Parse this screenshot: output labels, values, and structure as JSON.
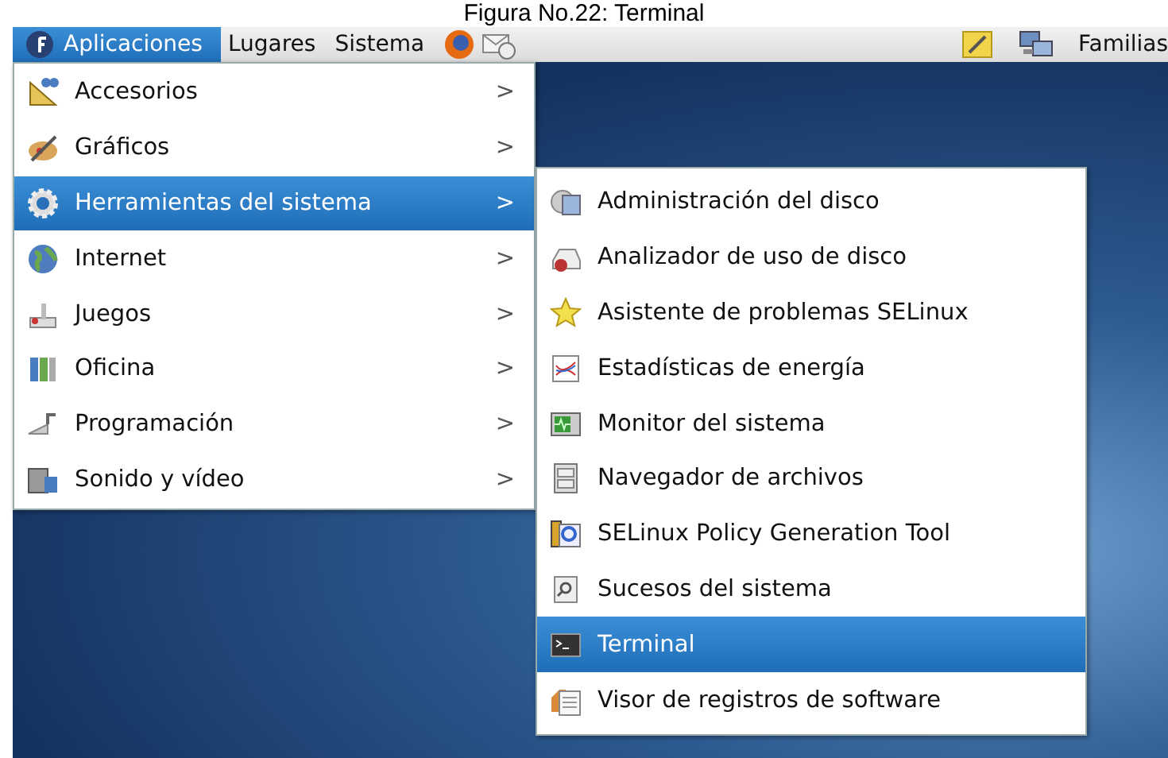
{
  "caption": "Figura No.22: Terminal",
  "panel": {
    "menus": [
      {
        "label": "Aplicaciones",
        "selected": true
      },
      {
        "label": "Lugares",
        "selected": false
      },
      {
        "label": "Sistema",
        "selected": false
      }
    ],
    "user": "Familias"
  },
  "menu": {
    "items": [
      {
        "label": "Accesorios",
        "arrow": ">",
        "selected": false
      },
      {
        "label": "Gráficos",
        "arrow": ">",
        "selected": false
      },
      {
        "label": "Herramientas del sistema",
        "arrow": ">",
        "selected": true
      },
      {
        "label": "Internet",
        "arrow": ">",
        "selected": false
      },
      {
        "label": "Juegos",
        "arrow": ">",
        "selected": false
      },
      {
        "label": "Oficina",
        "arrow": ">",
        "selected": false
      },
      {
        "label": "Programación",
        "arrow": ">",
        "selected": false
      },
      {
        "label": "Sonido y vídeo",
        "arrow": ">",
        "selected": false
      }
    ]
  },
  "submenu": {
    "items": [
      {
        "label": "Administración del disco",
        "selected": false
      },
      {
        "label": "Analizador de uso de disco",
        "selected": false
      },
      {
        "label": "Asistente de problemas SELinux",
        "selected": false
      },
      {
        "label": "Estadísticas de energía",
        "selected": false
      },
      {
        "label": "Monitor del sistema",
        "selected": false
      },
      {
        "label": "Navegador de archivos",
        "selected": false
      },
      {
        "label": "SELinux Policy Generation Tool",
        "selected": false
      },
      {
        "label": "Sucesos del sistema",
        "selected": false
      },
      {
        "label": "Terminal",
        "selected": true
      },
      {
        "label": "Visor de registros de software",
        "selected": false
      }
    ]
  }
}
